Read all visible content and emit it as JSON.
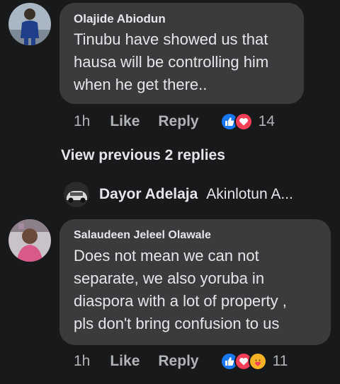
{
  "comments": [
    {
      "author": "Olajide Abiodun",
      "text": "Tinubu  have showed us that\nhausa will be controlling him\nwhen he get there..",
      "time": "1h",
      "like_label": "Like",
      "reply_label": "Reply",
      "reactions": [
        "like-reaction-icon",
        "love-reaction-icon"
      ],
      "reaction_count": "14"
    },
    {
      "author": "Salaudeen Jeleel Olawale",
      "text": "Does not mean we can not\nseparate, we also yoruba in\ndiaspora  with a lot of property  ,\npls don't  bring confusion  to us",
      "time": "1h",
      "like_label": "Like",
      "reply_label": "Reply",
      "reactions": [
        "like-reaction-icon",
        "love-reaction-icon",
        "care-reaction-icon"
      ],
      "reaction_count": "11"
    }
  ],
  "view_previous": "View previous 2 replies",
  "reply_preview": {
    "author": "Dayor Adelaja",
    "snippet": "Akinlotun A..."
  },
  "colors": {
    "background": "#18191a",
    "bubble": "#3a3b3c",
    "text": "#e4e6eb",
    "muted": "#b0b3b8",
    "like_blue": "#1877f2",
    "love_red": "#f33e58",
    "care_yellow": "#f7b125"
  }
}
